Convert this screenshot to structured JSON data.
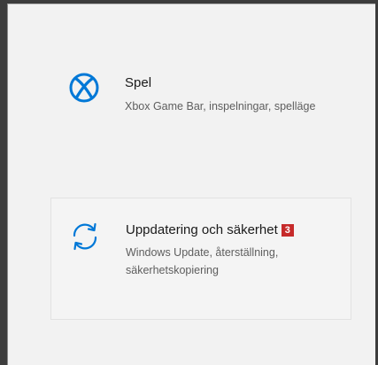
{
  "colors": {
    "accent": "#0078d7",
    "badge": "#c62a2a",
    "panel": "#f2f2f2"
  },
  "settings": {
    "tiles": [
      {
        "icon": "xbox-icon",
        "title": "Spel",
        "description": "Xbox Game Bar, inspelningar, spelläge"
      },
      {
        "icon": "sync-arrows-icon",
        "title": "Uppdatering och säkerhet",
        "badge": "3",
        "description": "Windows Update, återställning, säkerhetskopiering"
      }
    ]
  }
}
